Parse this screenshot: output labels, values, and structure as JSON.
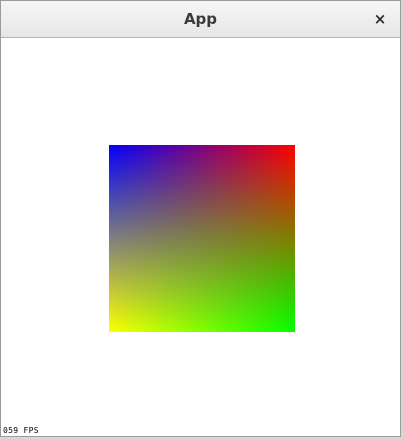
{
  "window": {
    "title": "App",
    "close_icon": "close-icon",
    "close_glyph": "×"
  },
  "scene": {
    "quad_colors": {
      "top_left": "#0000ff",
      "top_right": "#ff0000",
      "bottom_left": "#ffff00",
      "bottom_right": "#00ff00"
    }
  },
  "status": {
    "fps_text": "059 FPS"
  }
}
